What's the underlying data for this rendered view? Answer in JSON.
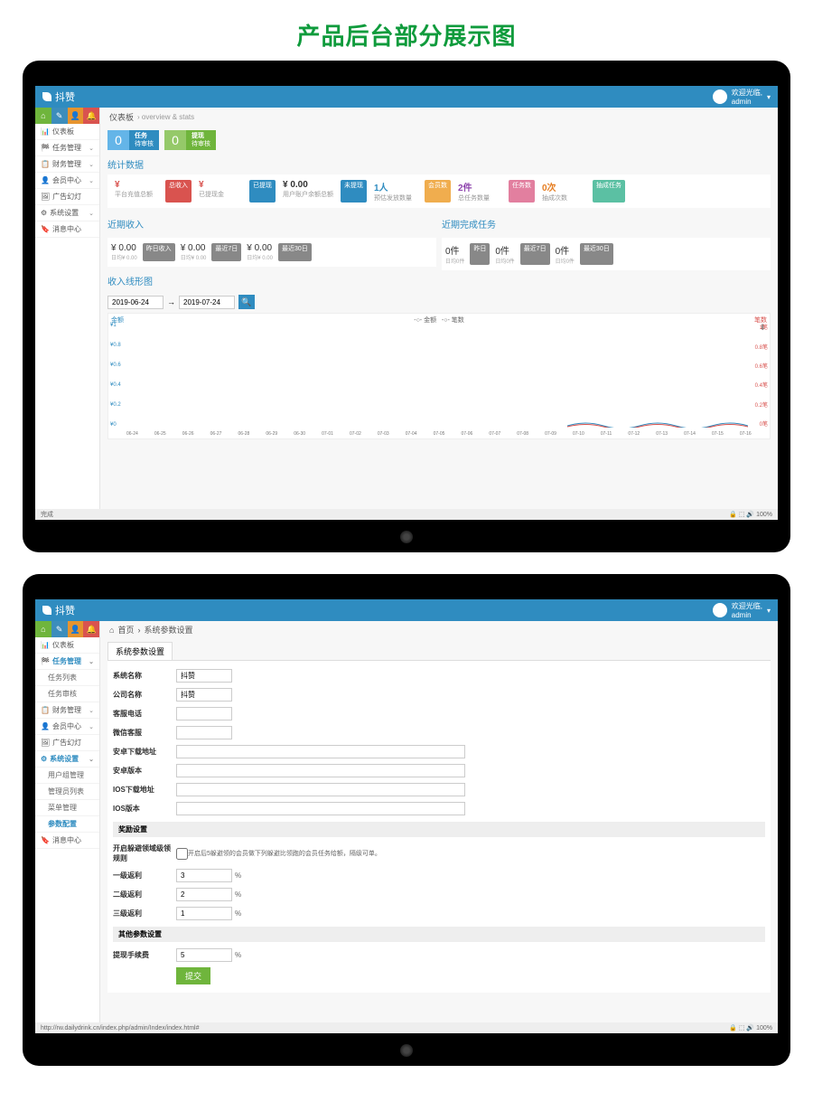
{
  "page_heading": "产品后台部分展示图",
  "brand": "抖赞",
  "user": {
    "welcome": "欢迎光临,",
    "name": "admin"
  },
  "sidebar1": [
    {
      "icon": "📊",
      "label": "仪表板",
      "expand": false
    },
    {
      "icon": "🏁",
      "label": "任务管理",
      "expand": true
    },
    {
      "icon": "📋",
      "label": "财务管理",
      "expand": true
    },
    {
      "icon": "👤",
      "label": "会员中心",
      "expand": true
    },
    {
      "icon": "🖼",
      "label": "广告幻灯",
      "expand": false
    },
    {
      "icon": "⚙",
      "label": "系统设置",
      "expand": true
    },
    {
      "icon": "🔖",
      "label": "消息中心",
      "expand": false
    }
  ],
  "crumb1": {
    "title": "仪表板",
    "sub": "overview & stats"
  },
  "statboxes": [
    {
      "num": "0",
      "line1": "任务",
      "line2": "待审核",
      "tone": "blue"
    },
    {
      "num": "0",
      "line1": "提现",
      "line2": "待审核",
      "tone": "green"
    }
  ],
  "stats_title": "统计数据",
  "kpis": [
    {
      "val": "¥",
      "lab": "平台充值总额",
      "color": "#d9534f",
      "badge": "总收入",
      "btone": "red"
    },
    {
      "val": "¥",
      "lab": "已提现金",
      "color": "#d9534f",
      "badge": "已提现",
      "btone": "blue"
    },
    {
      "val": "¥ 0.00",
      "lab": "用户账户余额总额",
      "color": "#333",
      "badge": "未提现",
      "btone": "blue"
    },
    {
      "val": "1人",
      "lab": "预估发放数量",
      "color": "#2f8cc0",
      "badge": "会员数",
      "btone": "orange"
    },
    {
      "val": "2件",
      "lab": "总任务数量",
      "color": "#8e44ad",
      "badge": "任务数",
      "btone": "pink"
    },
    {
      "val": "0次",
      "lab": "抽成次数",
      "color": "#e67e22",
      "badge": "抽成任务",
      "btone": "teal"
    }
  ],
  "period_left_title": "近期收入",
  "period_left": [
    {
      "v": "¥ 0.00",
      "s": "日均¥ 0.00",
      "badge": "昨日收入",
      "btone": "gray"
    },
    {
      "v": "¥ 0.00",
      "s": "日均¥ 0.00",
      "badge": "最近7日",
      "btone": "gray"
    },
    {
      "v": "¥ 0.00",
      "s": "日均¥ 0.00",
      "badge": "最近30日",
      "btone": "gray"
    }
  ],
  "period_right_title": "近期完成任务",
  "period_right": [
    {
      "v": "0件",
      "s": "日均0件",
      "badge": "昨日",
      "btone": "gray"
    },
    {
      "v": "0件",
      "s": "日均0件",
      "badge": "最近7日",
      "btone": "gray"
    },
    {
      "v": "0件",
      "s": "日均0件",
      "badge": "最近30日",
      "btone": "gray"
    }
  ],
  "chart_section_title": "收入线形图",
  "date_from": "2019-06-24",
  "date_to": "2019-07-24",
  "chart_data": {
    "type": "line",
    "title_left": "金额",
    "title_right": "笔数",
    "legend": [
      "金额",
      "笔数"
    ],
    "yaxis_left": [
      "¥1",
      "¥0.8",
      "¥0.6",
      "¥0.4",
      "¥0.2",
      "¥0"
    ],
    "yaxis_right": [
      "1笔",
      "0.8笔",
      "0.6笔",
      "0.4笔",
      "0.2笔",
      "0笔"
    ],
    "x": [
      "06-24",
      "06-25",
      "06-26",
      "06-27",
      "06-28",
      "06-29",
      "06-30",
      "07-01",
      "07-02",
      "07-03",
      "07-04",
      "07-05",
      "07-06",
      "07-07",
      "07-08",
      "07-09",
      "07-10",
      "07-11",
      "07-12",
      "07-13",
      "07-14",
      "07-15",
      "07-16"
    ],
    "series": [
      {
        "name": "金额",
        "values": [
          0,
          0,
          0,
          0,
          0,
          0,
          0,
          0,
          0,
          0,
          0,
          0,
          0,
          0,
          0,
          0,
          0,
          0,
          0,
          0,
          0,
          0,
          0
        ]
      },
      {
        "name": "笔数",
        "values": [
          0,
          0,
          0,
          0,
          0,
          0,
          0,
          0,
          0,
          0,
          0,
          0,
          0,
          0,
          0,
          0,
          0,
          0,
          0,
          0,
          0,
          0,
          0
        ]
      }
    ]
  },
  "status1": {
    "left": "完成",
    "right": "🔒 ⬚ 🔊 100%"
  },
  "sidebar2": {
    "items": [
      {
        "icon": "📊",
        "label": "仪表板"
      },
      {
        "icon": "🏁",
        "label": "任务管理",
        "active": true,
        "subs": [
          "任务列表",
          "任务审核"
        ]
      },
      {
        "icon": "📋",
        "label": "财务管理",
        "expand": true
      },
      {
        "icon": "👤",
        "label": "会员中心",
        "expand": true
      },
      {
        "icon": "🖼",
        "label": "广告幻灯"
      },
      {
        "icon": "⚙",
        "label": "系统设置",
        "active": true,
        "subs": [
          "用户组管理",
          "管理员列表",
          "菜单管理",
          "参数配置"
        ],
        "sub_active": 3
      },
      {
        "icon": "🔖",
        "label": "消息中心"
      }
    ]
  },
  "crumb2": {
    "home": "首页",
    "current": "系统参数设置"
  },
  "tab_label": "系统参数设置",
  "form": {
    "sys_name": {
      "label": "系统名称",
      "value": "抖赞"
    },
    "company": {
      "label": "公司名称",
      "value": "抖赞"
    },
    "phone": {
      "label": "客服电话",
      "value": ""
    },
    "wechat": {
      "label": "微信客服",
      "value": ""
    },
    "android_url": {
      "label": "安卓下载地址",
      "value": ""
    },
    "android_ver": {
      "label": "安卓版本",
      "value": ""
    },
    "ios_url": {
      "label": "IOS下载地址",
      "value": ""
    },
    "ios_ver": {
      "label": "IOS版本",
      "value": ""
    },
    "group_reward": "奖励设置",
    "reward_rule_label": "开启躲避领域级领规则",
    "reward_rule_note": "开启后5躲避领的会员做下列躲避比领跑的会员任务给额，隔级可单。",
    "lv1": {
      "label": "一级返利",
      "value": "3"
    },
    "lv2": {
      "label": "二级返利",
      "value": "2"
    },
    "lv3": {
      "label": "三级返利",
      "value": "1"
    },
    "group_other": "其他参数设置",
    "fee": {
      "label": "提现手续费",
      "value": "5"
    },
    "submit": "提交"
  },
  "status2": {
    "left": "http://rw.dailydrink.cn/index.php/admin/Index/index.html#",
    "right": "🔒 ⬚ 🔊 100%"
  }
}
